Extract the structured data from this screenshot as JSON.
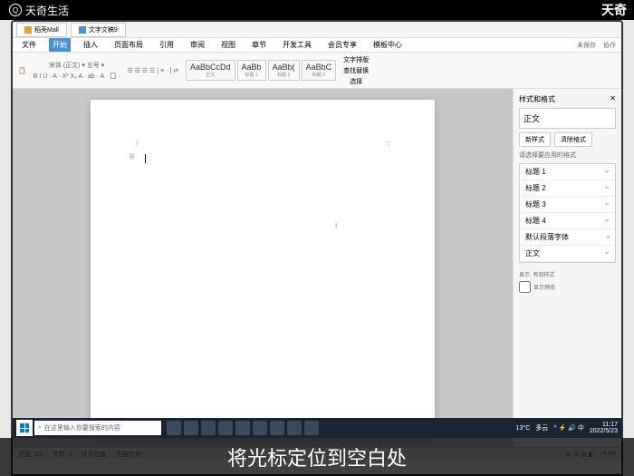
{
  "overlay": {
    "logo_text": "天奇生活",
    "right_text": "天奇"
  },
  "titlebar": {
    "tab1": "稻壳Mall",
    "tab2": "文字文稿9"
  },
  "ribbon": {
    "tabs": [
      "开始",
      "插入",
      "页面布局",
      "引用",
      "审阅",
      "视图",
      "章节",
      "开发工具",
      "会员专享",
      "模板中心"
    ],
    "file": "文件",
    "right1": "未保存",
    "right2": "协作",
    "font_group": "宋体 (正文)  ▾  五号 ▾",
    "font_btns": "B I U · A · X² X₂ A · ab · A · 囗 ·",
    "para_btns": "☰ ☰ ☰ ☰ | ≡ · | ⇄",
    "style_thumb": "AaBbCcDd",
    "style1": "AaBb",
    "style2": "AaBb(",
    "style3": "AaBbC",
    "style1_lbl": "正文",
    "style2_lbl": "标题 1",
    "style3_lbl": "标题 2",
    "find_lbl": "文字排版",
    "replace_lbl": "查找替换",
    "select_lbl": "选择"
  },
  "panel": {
    "title": "样式和格式",
    "current": "正文",
    "btn_new": "新样式",
    "btn_clear": "清除格式",
    "hint": "请选择要应用的格式",
    "items": [
      "标题 1",
      "标题 2",
      "标题 3",
      "标题 4",
      "默认段落字体"
    ],
    "body_item": "正文",
    "show_label": "显示: 有效样式",
    "preview_check": "显示预览"
  },
  "status": {
    "page": "页面: 1/1",
    "words": "字数: 0",
    "spell": "拼写检查",
    "doc": "文档校对",
    "zoom": "143%"
  },
  "taskbar": {
    "search_placeholder": "在这里输入你要搜索的内容",
    "temp": "13°C",
    "weather": "多云",
    "time": "11:17",
    "date": "2022/5/23"
  },
  "subtitle": "将光标定位到空白处",
  "doc": {
    "page_num": "第 ",
    "cursor_hint": "I"
  }
}
